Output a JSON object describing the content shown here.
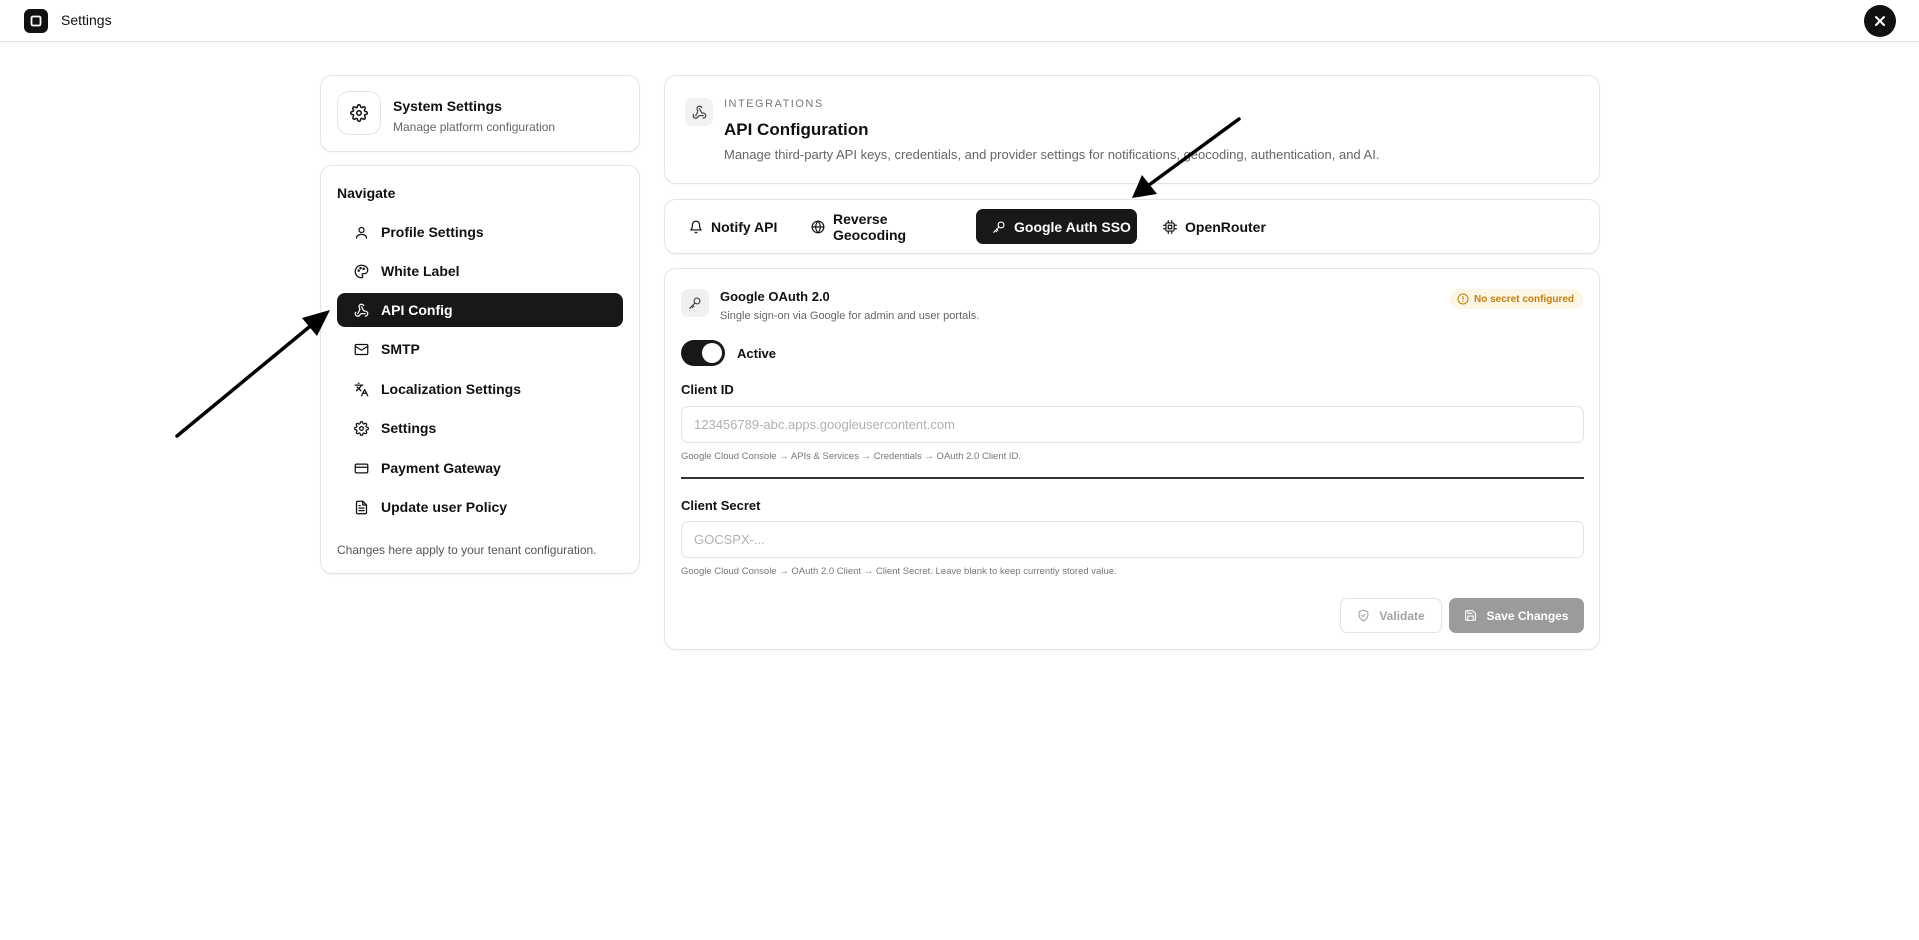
{
  "app": {
    "title": "Settings",
    "logo_icon": "app-square-icon",
    "close_icon": "close-icon"
  },
  "sidebar": {
    "header": {
      "icon": "gear-icon",
      "title": "System Settings",
      "subtitle": "Manage platform configuration"
    },
    "nav_heading": "Navigate",
    "items": [
      {
        "label": "Profile Settings",
        "icon": "user-icon",
        "active": false
      },
      {
        "label": "White Label",
        "icon": "palette-icon",
        "active": false
      },
      {
        "label": "API Config",
        "icon": "webhook-icon",
        "active": true
      },
      {
        "label": "SMTP",
        "icon": "mail-icon",
        "active": false
      },
      {
        "label": "Localization Settings",
        "icon": "languages-icon",
        "active": false
      },
      {
        "label": "Settings",
        "icon": "gear-icon",
        "active": false
      },
      {
        "label": "Payment Gateway",
        "icon": "credit-card-icon",
        "active": false
      },
      {
        "label": "Update user Policy",
        "icon": "document-icon",
        "active": false
      }
    ],
    "footer": "Changes here apply to your tenant configuration."
  },
  "integration": {
    "icon": "webhook-icon",
    "eyebrow": "INTEGRATIONS",
    "title": "API Configuration",
    "subtitle": "Manage third-party API keys, credentials, and provider settings for notifications, geocoding, authentication, and AI."
  },
  "tabs": [
    {
      "label": "Notify API",
      "icon": "bell-icon",
      "active": false
    },
    {
      "label": "Reverse Geocoding",
      "icon": "globe-icon",
      "active": false
    },
    {
      "label": "Google Auth SSO",
      "icon": "key-icon",
      "active": true
    },
    {
      "label": "OpenRouter",
      "icon": "cpu-icon",
      "active": false
    }
  ],
  "oauth": {
    "icon": "key-icon",
    "title": "Google OAuth 2.0",
    "subtitle": "Single sign-on via Google for admin and user portals.",
    "badge": {
      "label": "No secret configured",
      "icon": "info-circle-icon",
      "color": "#c47f0a"
    },
    "toggle": {
      "label": "Active",
      "on": true
    },
    "client_id": {
      "label": "Client ID",
      "value": "",
      "placeholder": "123456789-abc.apps.googleusercontent.com",
      "hint": "Google Cloud Console → APIs & Services → Credentials → OAuth 2.0 Client ID."
    },
    "client_secret": {
      "label": "Client Secret",
      "value": "",
      "placeholder": "GOCSPX-...",
      "hint": "Google Cloud Console → OAuth 2.0 Client → Client Secret. Leave blank to keep currently stored value."
    },
    "actions": {
      "validate": {
        "label": "Validate",
        "icon": "shield-check-icon"
      },
      "save": {
        "label": "Save Changes",
        "icon": "save-icon"
      }
    }
  },
  "colors": {
    "accent_dark": "#18181b",
    "badge_bg": "#fdf6e7",
    "badge_text": "#c47f0a",
    "save_disabled": "#9b9b9b"
  }
}
